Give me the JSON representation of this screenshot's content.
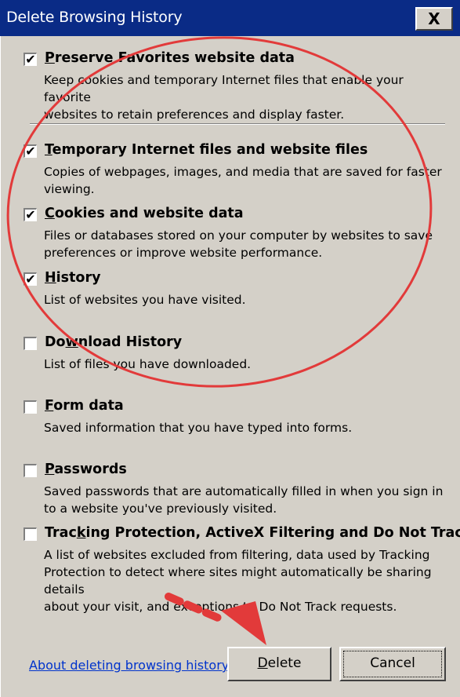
{
  "window": {
    "title": "Delete Browsing History",
    "close_label": "X"
  },
  "options": [
    {
      "title_pre": "",
      "title_u": "P",
      "title_post": "reserve Favorites website data",
      "checked": true,
      "check_mark": "✔",
      "desc_line1": "Keep cookies and temporary Internet files that enable your favorite",
      "desc_line2": "websites to retain preferences and display faster."
    },
    {
      "title_pre": "",
      "title_u": "T",
      "title_post": "emporary Internet files and website files",
      "checked": true,
      "check_mark": "✔",
      "desc_line1": "Copies of webpages, images, and media that are saved for faster",
      "desc_line2": "viewing."
    },
    {
      "title_pre": "",
      "title_u": "C",
      "title_post": "ookies and website data",
      "checked": true,
      "check_mark": "✔",
      "desc_line1": "Files or databases stored on your computer by websites to save",
      "desc_line2": "preferences or improve website performance."
    },
    {
      "title_pre": "",
      "title_u": "H",
      "title_post": "istory",
      "checked": true,
      "check_mark": "✔",
      "desc_line1": "List of websites you have visited.",
      "desc_line2": ""
    },
    {
      "title_pre": "Do",
      "title_u": "w",
      "title_post": "nload History",
      "checked": false,
      "check_mark": "",
      "desc_line1": "List of files you have downloaded.",
      "desc_line2": ""
    },
    {
      "title_pre": "",
      "title_u": "F",
      "title_post": "orm data",
      "checked": false,
      "check_mark": "",
      "desc_line1": "Saved information that you have typed into forms.",
      "desc_line2": ""
    },
    {
      "title_pre": "",
      "title_u": "P",
      "title_post": "asswords",
      "checked": false,
      "check_mark": "",
      "desc_line1": "Saved passwords that are automatically filled in when you sign in",
      "desc_line2": "to a website you've previously visited."
    },
    {
      "title_pre": "Trac",
      "title_u": "k",
      "title_post": "ing Protection, ActiveX Filtering and Do Not Track",
      "checked": false,
      "check_mark": "",
      "desc_line1": "A list of websites excluded from filtering, data used by Tracking",
      "desc_line2": "Protection to detect where sites might automatically be sharing details",
      "desc_line3": "about your visit, and exceptions to Do Not Track requests."
    }
  ],
  "footer": {
    "link_label": "About deleting browsing history",
    "delete_label_u": "D",
    "delete_label_rest": "elete",
    "cancel_label": "Cancel"
  },
  "annotation_colors": {
    "circle": "#e23a3a",
    "arrow": "#e23a3a"
  }
}
